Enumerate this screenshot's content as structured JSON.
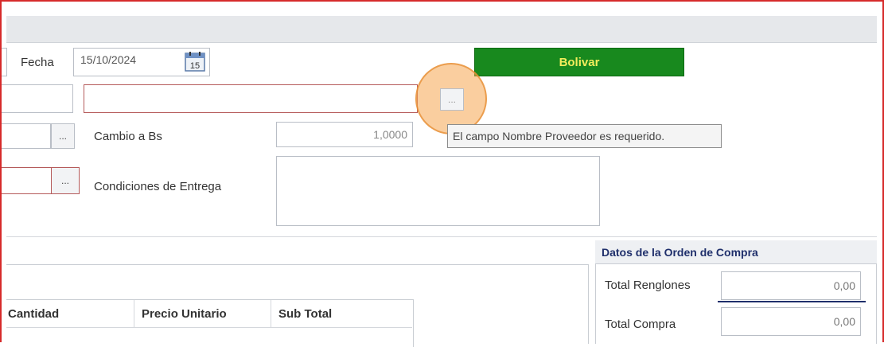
{
  "header": {
    "fecha_label": "Fecha",
    "fecha_value": "15/10/2024",
    "calendar_day": "15",
    "currency_button": "Bolivar"
  },
  "form": {
    "supplier_name_value": "",
    "dots": "...",
    "cambio_label": "Cambio a Bs",
    "cambio_value": "1,0000",
    "tooltip": "El campo Nombre Proveedor es requerido.",
    "condiciones_label": "Condiciones de Entrega",
    "condiciones_value": ""
  },
  "table": {
    "columns": [
      "Cantidad",
      "Precio Unitario",
      "Sub Total"
    ]
  },
  "summary": {
    "title": "Datos de la Orden de Compra",
    "total_renglones_label": "Total Renglones",
    "total_renglones_value": "0,00",
    "total_compra_label": "Total Compra",
    "total_compra_value": "0,00"
  },
  "colors": {
    "accent_green": "#18891e",
    "currency_text": "#f2ec5c",
    "error_border": "#b55a5a",
    "frame_red": "#d62a2a"
  }
}
